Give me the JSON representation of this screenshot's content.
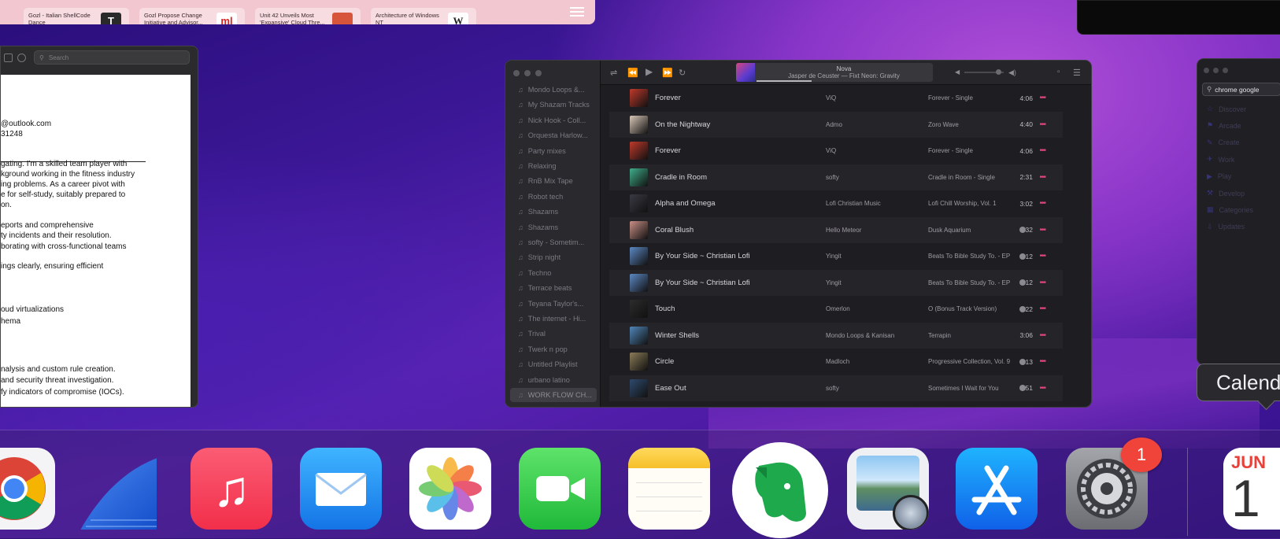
{
  "safari": {
    "tiles": [
      {
        "text": "Gozl - Italian ShellCode Dance",
        "badge": "T"
      },
      {
        "text": "Gozl Propose Change Initiative and Advisor...",
        "badge": "ml"
      },
      {
        "text": "Unit 42 Unveils Most 'Expansive' Cloud Thre...",
        "badge": ""
      },
      {
        "text": "Architecture of Windows NT",
        "badge": "W"
      }
    ]
  },
  "doc": {
    "search_placeholder": "Search",
    "lines": [
      "@outlook.com",
      "31248",
      "gating. I'm a skilled team player with",
      "kground working in the fitness industry",
      "ing problems. As a career pivot with",
      "e for self-study, suitably prepared to",
      "on.",
      "eports and comprehensive",
      "ty incidents and their resolution.",
      "borating with cross-functional teams",
      "ings clearly, ensuring efficient",
      "oud virtualizations",
      "hema",
      "nalysis and custom rule creation.",
      "and security threat investigation.",
      "fy indicators of compromise (IOCs)."
    ]
  },
  "music": {
    "now_playing": {
      "title": "Nova",
      "subtitle": "Jasper de Ceuster — Fixt Neon: Gravity"
    },
    "playlists": [
      "Mondo Loops &...",
      "My Shazam Tracks",
      "Nick Hook - Coll...",
      "Orquesta Harlow...",
      "Party mixes",
      "Relaxing",
      "RnB Mix Tape",
      "Robot tech",
      "Shazams",
      "Shazams",
      "softy - Sometim...",
      "Strip night",
      "Techno",
      "Terrace beats",
      "Teyana Taylor's...",
      "The internet - Hi...",
      "Trival",
      "Twerk n pop",
      "Untitled Playlist",
      "urbano latino",
      "WORK FLOW CH..."
    ],
    "selected_playlist": "WORK FLOW CH...",
    "tracks": [
      {
        "title": "Forever",
        "artist": "ViQ",
        "album": "Forever - Single",
        "time": "4:06",
        "download": false,
        "color": "#c0392b"
      },
      {
        "title": "On the Nightway",
        "artist": "Admo",
        "album": "Zoro Wave",
        "time": "4:40",
        "download": false,
        "color": "#d9c7b8"
      },
      {
        "title": "Forever",
        "artist": "ViQ",
        "album": "Forever - Single",
        "time": "4:06",
        "download": false,
        "color": "#c0392b"
      },
      {
        "title": "Cradle in Room",
        "artist": "softy",
        "album": "Cradle in Room - Single",
        "time": "2:31",
        "download": false,
        "color": "#3fae8a"
      },
      {
        "title": "Alpha and Omega",
        "artist": "Lofi Christian Music",
        "album": "Lofi Chill Worship, Vol. 1",
        "time": "3:02",
        "download": false,
        "color": "#3a3a44"
      },
      {
        "title": "Coral Blush",
        "artist": "Hello Meteor",
        "album": "Dusk Aquarium",
        "time": "5:32",
        "download": true,
        "color": "#c98f86"
      },
      {
        "title": "By Your Side ~ Christian Lofi",
        "artist": "Yingit",
        "album": "Beats To Bible Study To. - EP",
        "time": "2:12",
        "download": true,
        "color": "#5c88c4"
      },
      {
        "title": "By Your Side ~ Christian Lofi",
        "artist": "Yingit",
        "album": "Beats To Bible Study To. - EP",
        "time": "2:12",
        "download": true,
        "color": "#5c88c4"
      },
      {
        "title": "Touch",
        "artist": "Omerlon",
        "album": "O (Bonus Track Version)",
        "time": "3:22",
        "download": true,
        "color": "#2c2c2c"
      },
      {
        "title": "Winter Shells",
        "artist": "Mondo Loops & Kanisan",
        "album": "Terrapin",
        "time": "3:06",
        "download": false,
        "color": "#4f86b8"
      },
      {
        "title": "Circle",
        "artist": "Madloch",
        "album": "Progressive Collection, Vol. 9",
        "time": "9:13",
        "download": true,
        "color": "#8b7c58"
      },
      {
        "title": "Ease Out",
        "artist": "softy",
        "album": "Sometimes I Wait for You",
        "time": "2:51",
        "download": true,
        "color": "#2f4b6e"
      }
    ]
  },
  "store": {
    "search_value": "chrome google",
    "nav": [
      "Discover",
      "Arcade",
      "Create",
      "Work",
      "Play",
      "Develop",
      "Categories",
      "Updates"
    ]
  },
  "tooltip": {
    "text": "Calend"
  },
  "dock": {
    "apps": [
      "Chrome",
      "Wireshark",
      "Music",
      "Mail",
      "Photos",
      "FaceTime",
      "Notes",
      "Evernote",
      "Preview",
      "App Store",
      "System Preferences",
      "Calendar"
    ],
    "settings_badge": "1",
    "calendar_month": "JUN",
    "calendar_day": "1"
  }
}
